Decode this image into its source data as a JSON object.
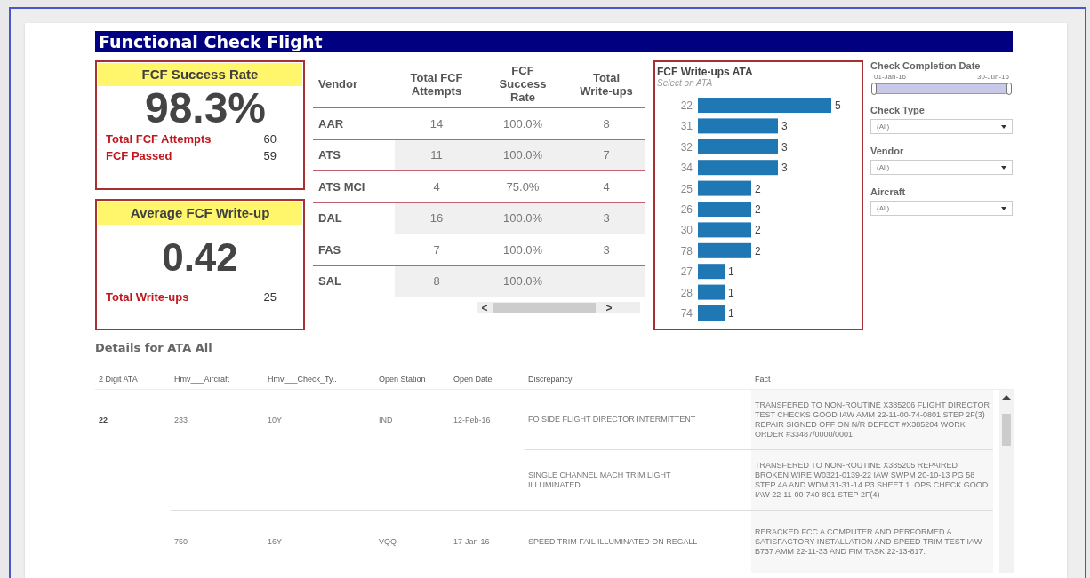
{
  "title": "Functional Check Flight",
  "kpis": [
    {
      "title": "FCF Success Rate",
      "value": "98.3%",
      "stats": [
        {
          "label": "Total FCF Attempts",
          "value": "60"
        },
        {
          "label": "FCF Passed",
          "value": "59"
        }
      ]
    },
    {
      "title": "Average FCF Write-up",
      "value": "0.42",
      "stats": [
        {
          "label": "Total Write-ups",
          "value": "25"
        }
      ]
    }
  ],
  "vendor_table": {
    "columns": [
      "Vendor",
      "Total FCF Attempts",
      "FCF Success Rate",
      "Total Write-ups"
    ],
    "rows": [
      [
        "AAR",
        "14",
        "100.0%",
        "8"
      ],
      [
        "ATS",
        "11",
        "100.0%",
        "7"
      ],
      [
        "ATS MCI",
        "4",
        "75.0%",
        "4"
      ],
      [
        "DAL",
        "16",
        "100.0%",
        "3"
      ],
      [
        "FAS",
        "7",
        "100.0%",
        "3"
      ],
      [
        "SAL",
        "8",
        "100.0%",
        ""
      ]
    ],
    "scroll_left": "<",
    "scroll_right": ">"
  },
  "ata_chart": {
    "subtitle": "Select on ATA",
    "chart_data": {
      "type": "bar",
      "orientation": "horizontal",
      "title": "FCF Write-ups ATA",
      "categories": [
        "22",
        "31",
        "32",
        "34",
        "25",
        "26",
        "30",
        "78",
        "27",
        "28",
        "74"
      ],
      "values": [
        5,
        3,
        3,
        3,
        2,
        2,
        2,
        2,
        1,
        1,
        1
      ],
      "data_labels": true
    }
  },
  "filters": {
    "date": {
      "label": "Check Completion Date",
      "start": "01-Jan-16",
      "end": "30-Jun-16",
      "level": 1
    },
    "dropdowns": [
      {
        "label": "Check Type",
        "value": "(All)"
      },
      {
        "label": "Vendor",
        "value": "(All)"
      },
      {
        "label": "Aircraft",
        "value": "(All)"
      }
    ]
  },
  "details": {
    "heading": "Details for ATA All",
    "columns": [
      "2 Digit ATA",
      "Hmv___Aircraft",
      "Hmv___Check_Ty..",
      "Open Station",
      "Open Date",
      "Discrepancy",
      "Fact"
    ],
    "rows": [
      {
        "ata": "22",
        "aircraft": "233",
        "check_type": "10Y",
        "station": "IND",
        "date": "12-Feb-16",
        "discrepancy": "FO SIDE FLIGHT DIRECTOR INTERMITTENT",
        "fact": "TRANSFERED TO NON-ROUTINE X385206 FLIGHT DIRECTOR TEST CHECKS GOOD IAW AMM 22-11-00-74-0801 STEP 2F(3) REPAIR SIGNED OFF ON N/R DEFECT #X385204 WORK ORDER #33487/0000/0001"
      },
      {
        "discrepancy": "SINGLE CHANNEL MACH TRIM LIGHT ILLUMINATED",
        "fact": "TRANSFERED TO NON-ROUTINE X385205 REPAIRED BROKEN WIRE W0321-0139-22 IAW SWPM 20-10-13 PG 58 STEP 4A AND WDM 31-31-14 P3 SHEET 1. OPS CHECK GOOD IAW 22-11-00-740-801 STEP 2F(4)"
      },
      {
        "aircraft": "750",
        "check_type": "16Y",
        "station": "VQQ",
        "date": "17-Jan-16",
        "discrepancy": "SPEED TRIM FAIL ILLUMINATED ON RECALL",
        "fact": "RERACKED FCC A COMPUTER AND PERFORMED A SATISFACTORY INSTALLATION AND SPEED TRIM TEST IAW B737 AMM 22-11-33 AND FIM TASK 22-13-817."
      }
    ]
  }
}
